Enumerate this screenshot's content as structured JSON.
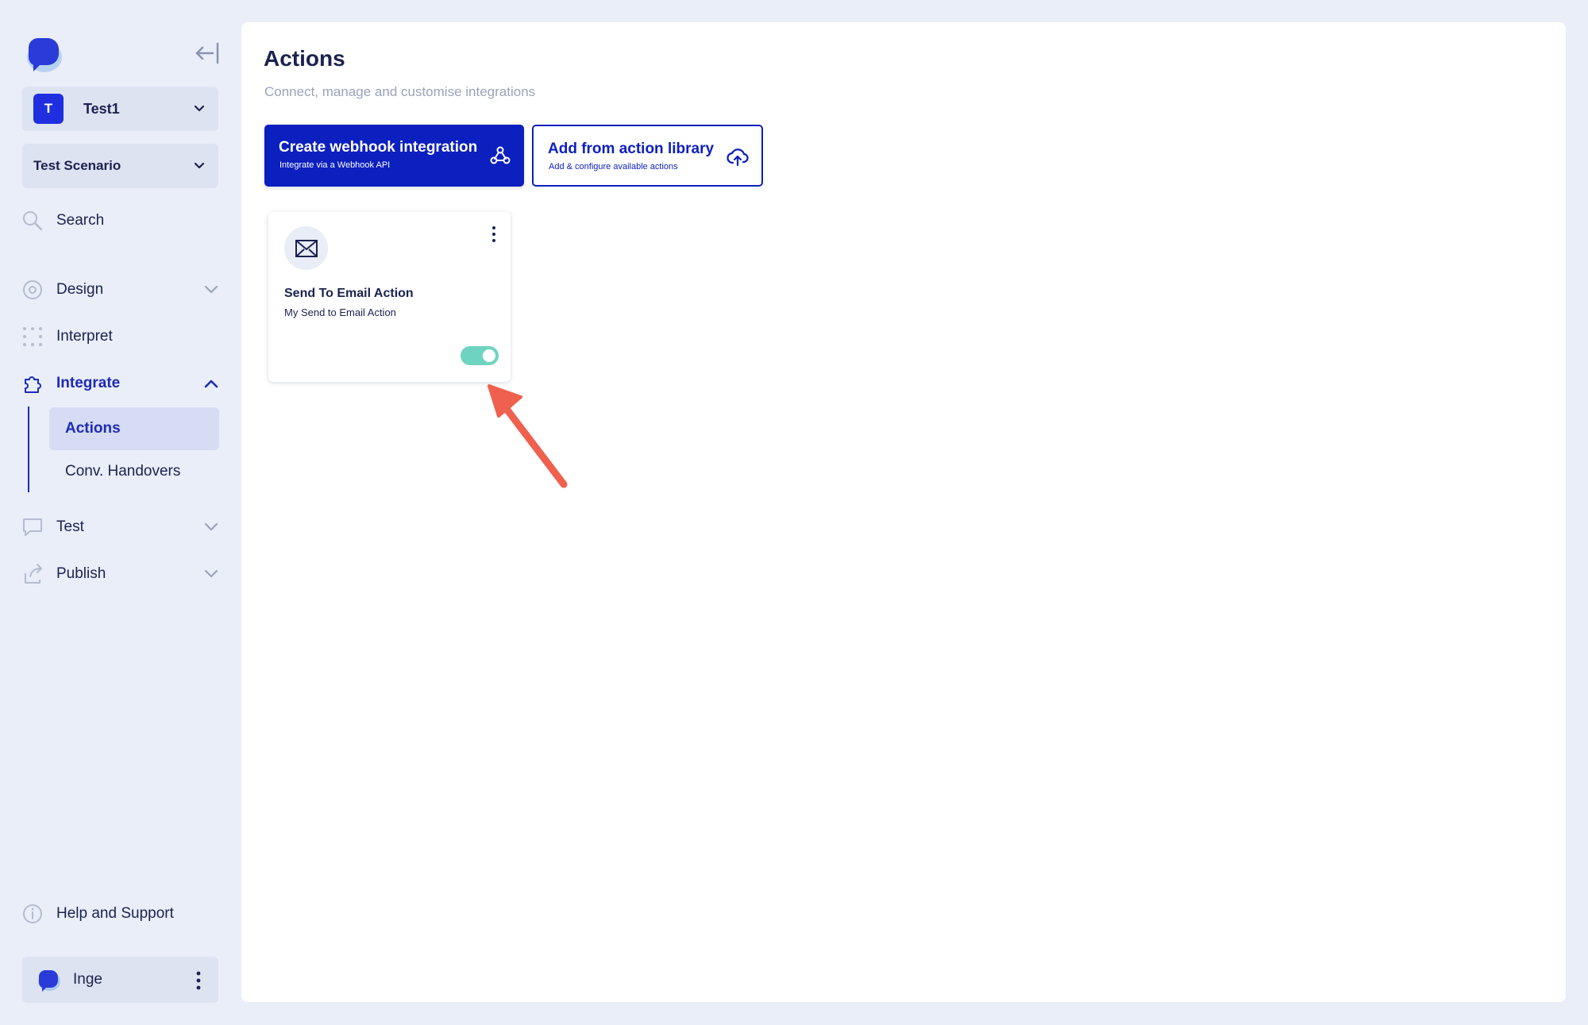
{
  "sidebar": {
    "workspace": {
      "initial": "T",
      "name": "Test1"
    },
    "scenario": {
      "name": "Test Scenario"
    },
    "nav": {
      "search": "Search",
      "design": "Design",
      "interpret": "Interpret",
      "integrate": "Integrate",
      "test": "Test",
      "publish": "Publish"
    },
    "subnav": {
      "actions": "Actions",
      "handovers": "Conv. Handovers"
    },
    "help": "Help and Support",
    "user": {
      "name": "Inge"
    }
  },
  "main": {
    "title": "Actions",
    "subtitle": "Connect, manage and customise integrations",
    "primary_button": {
      "title": "Create webhook integration",
      "description": "Integrate via a Webhook API"
    },
    "secondary_button": {
      "title": "Add from action library",
      "description": "Add & configure available actions"
    },
    "cards": [
      {
        "title": "Send To Email Action",
        "description": "My Send to Email Action",
        "enabled": true
      }
    ]
  },
  "colors": {
    "accent": "#0c1fbf",
    "toggle_on": "#6fd3c1",
    "annotation_arrow": "#f0604e",
    "background": "#e9eef9"
  },
  "icons": {
    "collapse": "collapse-sidebar-icon",
    "search": "search-icon",
    "design": "palette-icon",
    "interpret": "dots-grid-icon",
    "integrate": "puzzle-icon",
    "test": "chat-bubble-icon",
    "publish": "share-icon",
    "help": "info-icon",
    "webhook": "webhook-icon",
    "library": "cloud-upload-icon",
    "email": "envelope-icon"
  }
}
